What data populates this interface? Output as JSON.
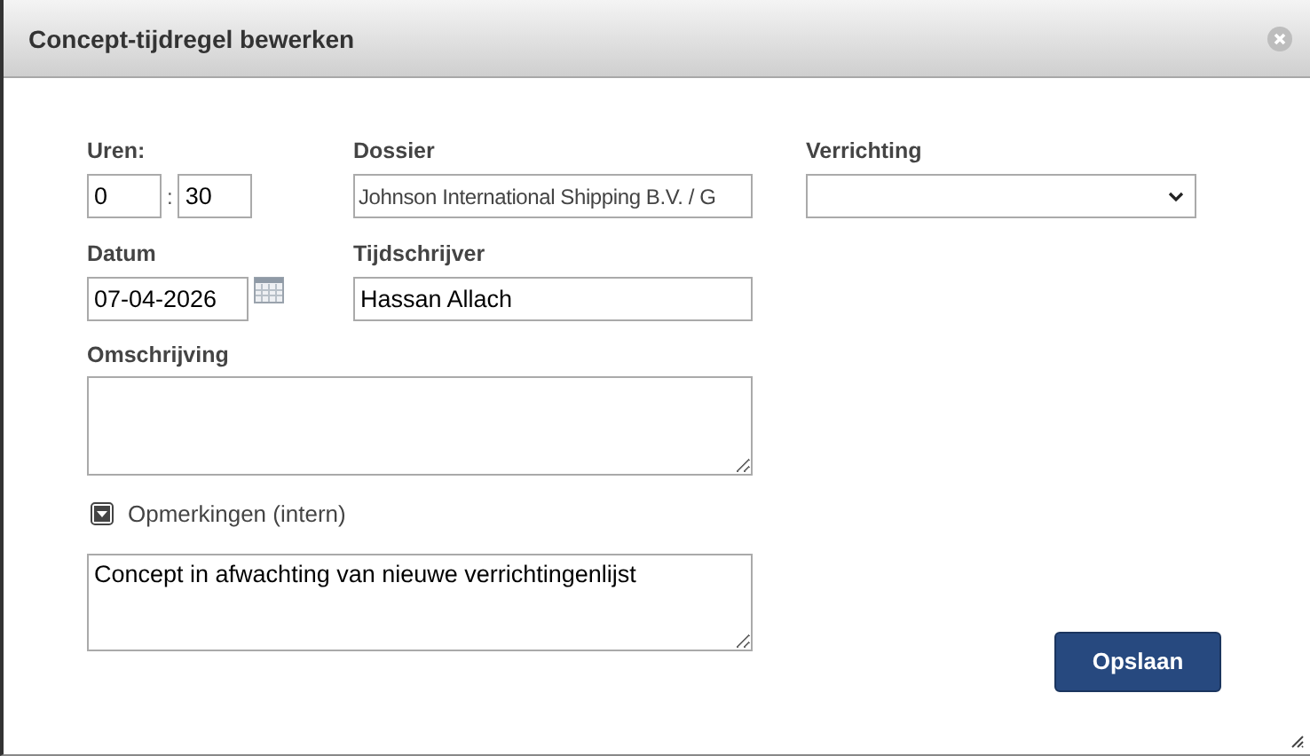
{
  "dialog": {
    "title": "Concept-tijdregel bewerken"
  },
  "fields": {
    "hours_label": "Uren:",
    "hours": "0",
    "separator": ":",
    "minutes": "30",
    "dossier_label": "Dossier",
    "dossier": "Johnson International Shipping B.V. / G",
    "activity_label": "Verrichting",
    "date_label": "Datum",
    "date": "07-04-2026",
    "writer_label": "Tijdschrijver",
    "writer": "Hassan Allach",
    "description_label": "Omschrijving"
  },
  "remarks": {
    "label": "Opmerkingen (intern)",
    "expanded": true,
    "value": "Concept in afwachting van nieuwe verrichtingenlijst"
  },
  "buttons": [
    {
      "label": "Opslaan"
    }
  ]
}
